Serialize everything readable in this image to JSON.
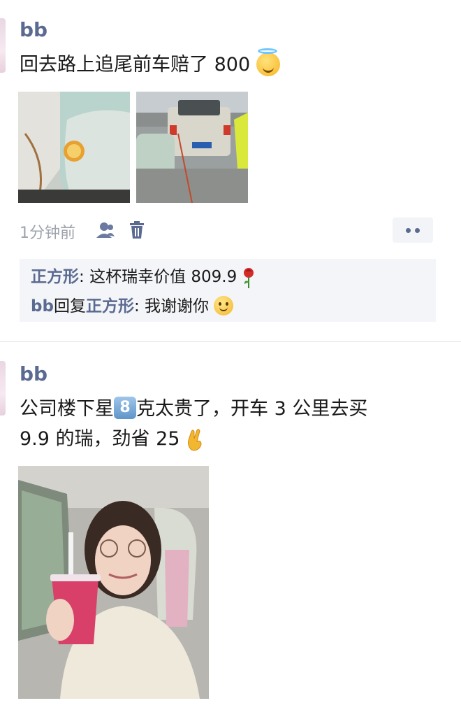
{
  "posts": [
    {
      "author": "bb",
      "text": "回去路上追尾前车赔了 800",
      "text_emoji": "smiling-face-with-halo",
      "time": "1分钟前",
      "comments": [
        {
          "author": "正方形",
          "sep": ": ",
          "text": "这杯瑞幸价值 809.9",
          "emoji": "rose"
        },
        {
          "author": "bb",
          "reply_word": "回复",
          "target": "正方形",
          "sep": ": ",
          "text": "我谢谢你",
          "emoji": "slightly-smiling-face"
        }
      ]
    },
    {
      "author": "bb",
      "text_part1": "公司楼下星",
      "keycap": "8",
      "text_part2": "克太贵了，开车 3 公里去买",
      "text_line2": "9.9 的瑞，劲省 25",
      "text_emoji": "crossed-fingers"
    }
  ],
  "icons": [
    "user-visibility-icon",
    "trash-icon",
    "more-icon"
  ]
}
